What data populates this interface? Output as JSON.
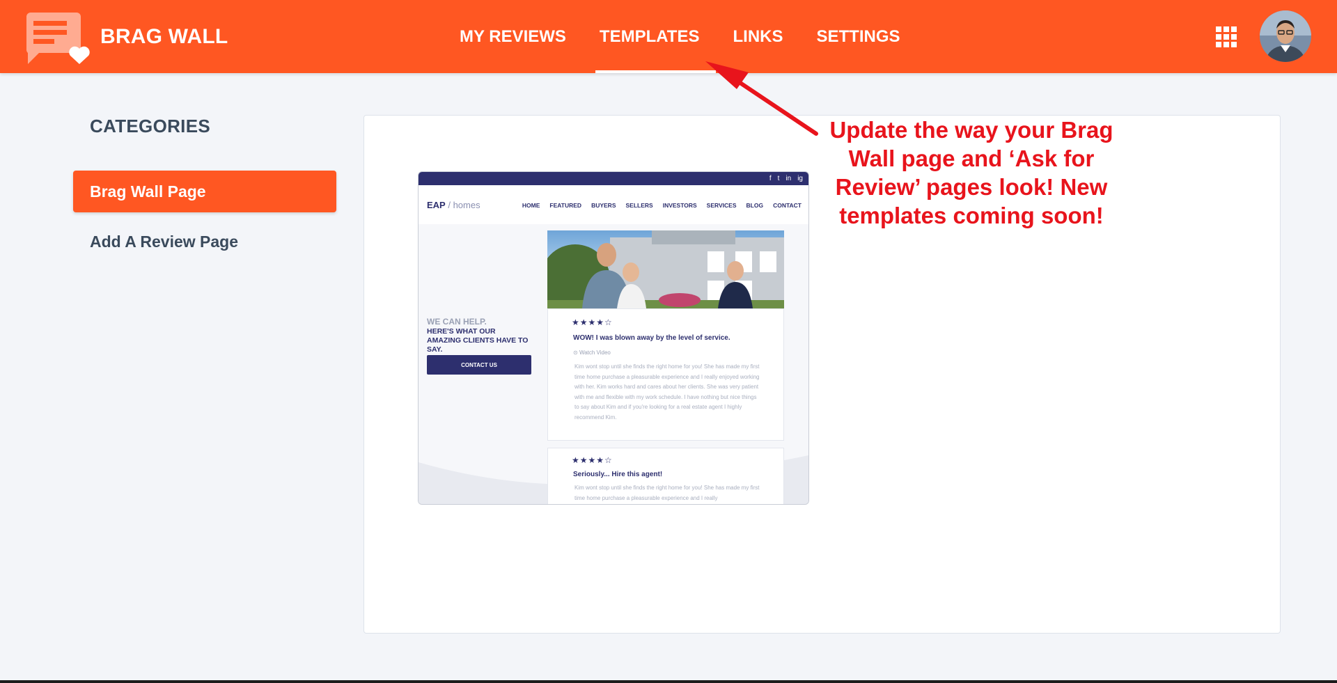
{
  "app": {
    "brand": "BRAG WALL"
  },
  "nav": {
    "items": [
      {
        "label": "MY REVIEWS",
        "active": false
      },
      {
        "label": "TEMPLATES",
        "active": true
      },
      {
        "label": "LINKS",
        "active": false
      },
      {
        "label": "SETTINGS",
        "active": false
      }
    ]
  },
  "header_icons": {
    "apps": "grid-icon",
    "avatar": "user-avatar"
  },
  "sidebar": {
    "title": "CATEGORIES",
    "items": [
      {
        "label": "Brag Wall Page",
        "active": true
      },
      {
        "label": "Add A Review Page",
        "active": false
      }
    ]
  },
  "preview": {
    "social_icons": [
      "f",
      "t",
      "in",
      "ig"
    ],
    "logo_main": "EAP",
    "logo_sep": " / homes",
    "menu": [
      "HOME",
      "FEATURED",
      "BUYERS",
      "SELLERS",
      "INVESTORS",
      "SERVICES",
      "BLOG",
      "CONTACT"
    ],
    "left_title": "WE CAN HELP.",
    "left_subtitle": "HERE'S WHAT OUR AMAZING CLIENTS HAVE TO SAY.",
    "contact_button": "CONTACT US",
    "review1": {
      "stars": "★★★★☆",
      "title": "WOW! I was blown away by the level of service.",
      "watch": "Watch Video",
      "text": "Kim wont stop until she finds the right home for you! She has made my first time home purchase a pleasurable experience and I really enjoyed working with her. Kim works hard and cares about her clients. She was very patient with me and flexible with my work schedule. I have nothing but nice things to say about Kim and if you're looking for a real estate agent I highly recommend Kim."
    },
    "review2": {
      "stars": "★★★★☆",
      "title": "Seriously... Hire this agent!",
      "text": "Kim wont stop until she finds the right home for you! She has made my first time home purchase a pleasurable experience and I really"
    }
  },
  "annotation": {
    "text": "Update the way your Brag Wall page and ‘Ask for Review’ pages look! New templates coming soon!",
    "color": "#e8141c"
  },
  "colors": {
    "accent": "#ff5722",
    "navy": "#2d2f6e",
    "text_dark": "#3a4a5c"
  }
}
